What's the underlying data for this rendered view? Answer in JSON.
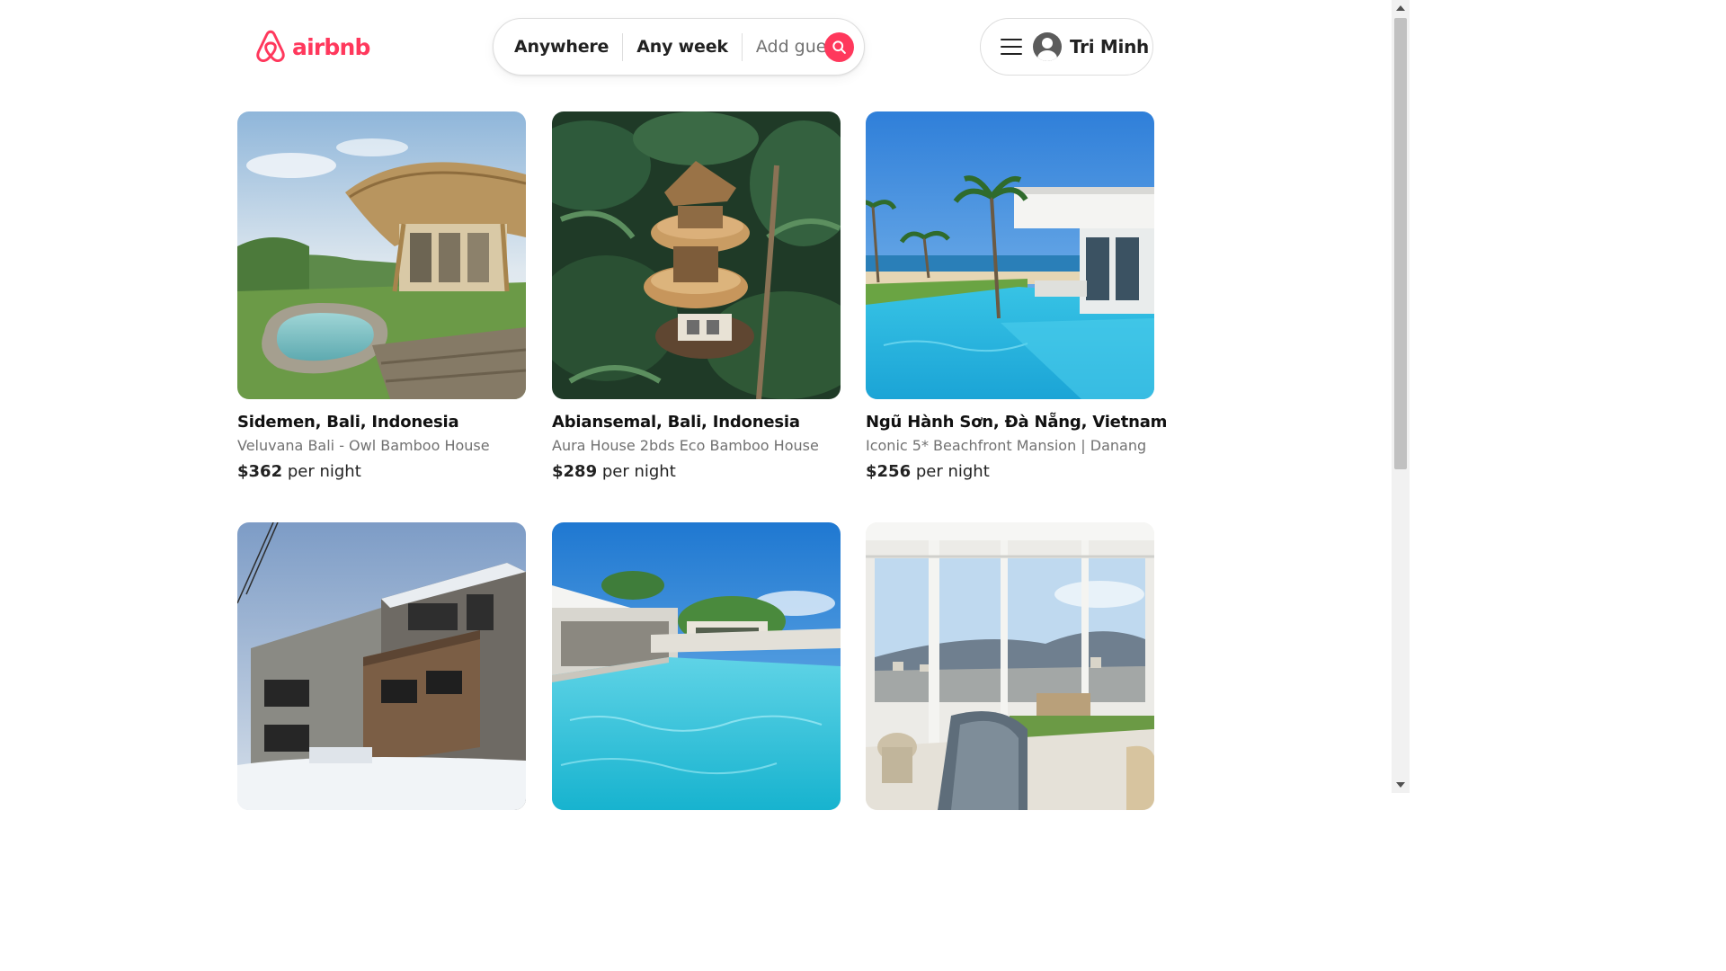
{
  "brand": {
    "name": "airbnb",
    "color": "#ff385c",
    "icon": "airbnb-logo-icon"
  },
  "search": {
    "location": "Anywhere",
    "dates": "Any week",
    "guests_placeholder": "Add guests",
    "button_icon": "search-icon"
  },
  "user_menu": {
    "menu_icon": "hamburger-menu-icon",
    "avatar_icon": "user-avatar-icon",
    "name": "Tri Minh"
  },
  "listings": [
    {
      "location": "Sidemen, Bali, Indonesia",
      "title": "Veluvana Bali - Owl Bamboo House",
      "price": "$362",
      "price_unit": "per night"
    },
    {
      "location": "Abiansemal, Bali, Indonesia",
      "title": "Aura House 2bds Eco Bamboo House",
      "price": "$289",
      "price_unit": "per night"
    },
    {
      "location": "Ngũ Hành Sơn, Đà Nẵng, Vietnam",
      "title": "Iconic 5* Beachfront Mansion | Danang",
      "price": "$256",
      "price_unit": "per night"
    },
    {
      "location": "",
      "title": "",
      "price": "",
      "price_unit": ""
    },
    {
      "location": "",
      "title": "",
      "price": "",
      "price_unit": ""
    },
    {
      "location": "",
      "title": "",
      "price": "",
      "price_unit": ""
    }
  ]
}
